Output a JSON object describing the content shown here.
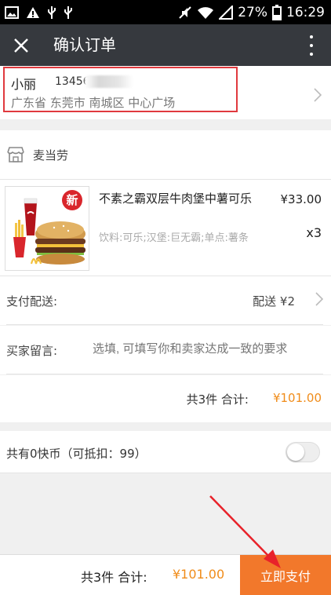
{
  "status_bar": {
    "battery": "27%",
    "time": "16:29"
  },
  "header": {
    "title": "确认订单"
  },
  "address": {
    "name": "小丽",
    "phone": "13456",
    "detail": "广东省 东莞市 南城区 中心广场"
  },
  "store": {
    "name": "麦当劳"
  },
  "product": {
    "name": "不素之霸双层牛肉堡中薯可乐",
    "options": "饮料:可乐;汉堡:巨无霸;单点:薯条",
    "price": "¥33.00",
    "quantity": "x3",
    "badge": "新"
  },
  "shipping": {
    "label": "支付配送:",
    "value": "配送 ¥2"
  },
  "message": {
    "label": "买家留言:",
    "placeholder": "选填, 可填写你和卖家达成一致的要求"
  },
  "summary": {
    "count_text": "共3件  合计:",
    "amount": "¥101.00"
  },
  "coins": {
    "label": "共有0快币（可抵扣：99）"
  },
  "bottom_bar": {
    "count_text": "共3件 合计:",
    "amount": "¥101.00",
    "pay_label": "立即支付"
  },
  "colors": {
    "accent_orange": "#f2782b",
    "price_orange": "#f08c1a",
    "highlight_red": "#e0393e",
    "header_bg": "#36393e"
  }
}
